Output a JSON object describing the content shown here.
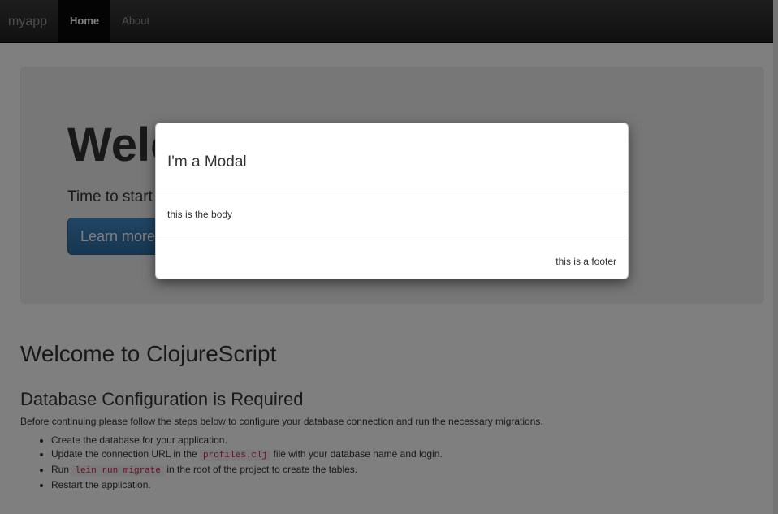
{
  "navbar": {
    "brand": "myapp",
    "items": [
      {
        "label": "Home"
      },
      {
        "label": "About"
      }
    ]
  },
  "jumbotron": {
    "title": "Welcome to my library",
    "subtitle": "Time to start building your site!",
    "button_label": "Learn more »"
  },
  "main": {
    "heading": "Welcome to ClojureScript",
    "subheading": "Database Configuration is Required",
    "intro": "Before continuing please follow the steps below to configure your database connection and run the necessary migrations.",
    "steps": [
      {
        "text": "Create the database for your application."
      },
      {
        "pre": "Update the connection URL in the ",
        "code": "profiles.clj",
        "post": " file with your database name and login."
      },
      {
        "pre": "Run ",
        "code": "lein run migrate",
        "post": " in the root of the project to create the tables."
      },
      {
        "text": "Restart the application."
      }
    ]
  },
  "modal": {
    "title": "I'm a Modal",
    "body": "this is the body",
    "footer": "this is a footer"
  }
}
